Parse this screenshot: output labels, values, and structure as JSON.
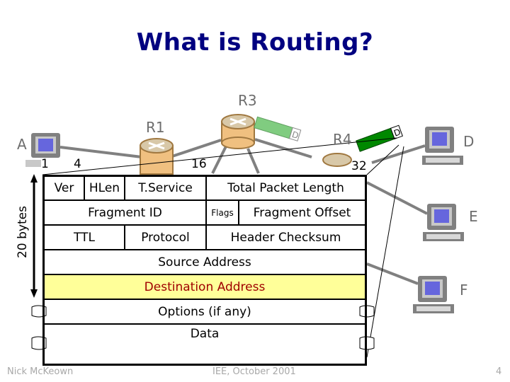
{
  "slide": {
    "title": "What is Routing?",
    "page_number": "4",
    "footer_left": "Nick McKeown",
    "footer_center": "IEE, October 2001"
  },
  "network": {
    "hosts": [
      {
        "id": "A",
        "label": "A"
      },
      {
        "id": "D",
        "label": "D"
      },
      {
        "id": "E",
        "label": "E"
      },
      {
        "id": "F",
        "label": "F"
      }
    ],
    "routers": [
      {
        "id": "R1",
        "label": "R1"
      },
      {
        "id": "R3",
        "label": "R3"
      },
      {
        "id": "R4",
        "label": "R4"
      }
    ],
    "packets": [
      {
        "location": "near R3",
        "destination_tag": "D",
        "color": "#80cc80"
      },
      {
        "location": "near R4",
        "destination_tag": "D",
        "color": "#008800"
      }
    ],
    "link_color": "#808080",
    "host_screen_color": "#6666dd",
    "router_color": "#f0c080"
  },
  "ip_header": {
    "bit_labels": [
      "1",
      "4",
      "16",
      "32"
    ],
    "size_label": "20 bytes",
    "rows": [
      {
        "cells": [
          {
            "label": "Ver"
          },
          {
            "label": "HLen"
          },
          {
            "label": "T.Service"
          },
          {
            "label": "Total Packet Length"
          }
        ]
      },
      {
        "cells": [
          {
            "label": "Fragment ID"
          },
          {
            "label": "Flags"
          },
          {
            "label": "Fragment Offset"
          }
        ]
      },
      {
        "cells": [
          {
            "label": "TTL"
          },
          {
            "label": "Protocol"
          },
          {
            "label": "Header Checksum"
          }
        ]
      },
      {
        "cells": [
          {
            "label": "Source Address"
          }
        ]
      },
      {
        "cells": [
          {
            "label": "Destination Address"
          }
        ],
        "highlight": true
      },
      {
        "cells": [
          {
            "label": "Options (if any)"
          }
        ]
      },
      {
        "cells": [
          {
            "label": "Data"
          }
        ]
      }
    ],
    "highlight_bg": "#ffff99",
    "highlight_text": "#a00000"
  }
}
